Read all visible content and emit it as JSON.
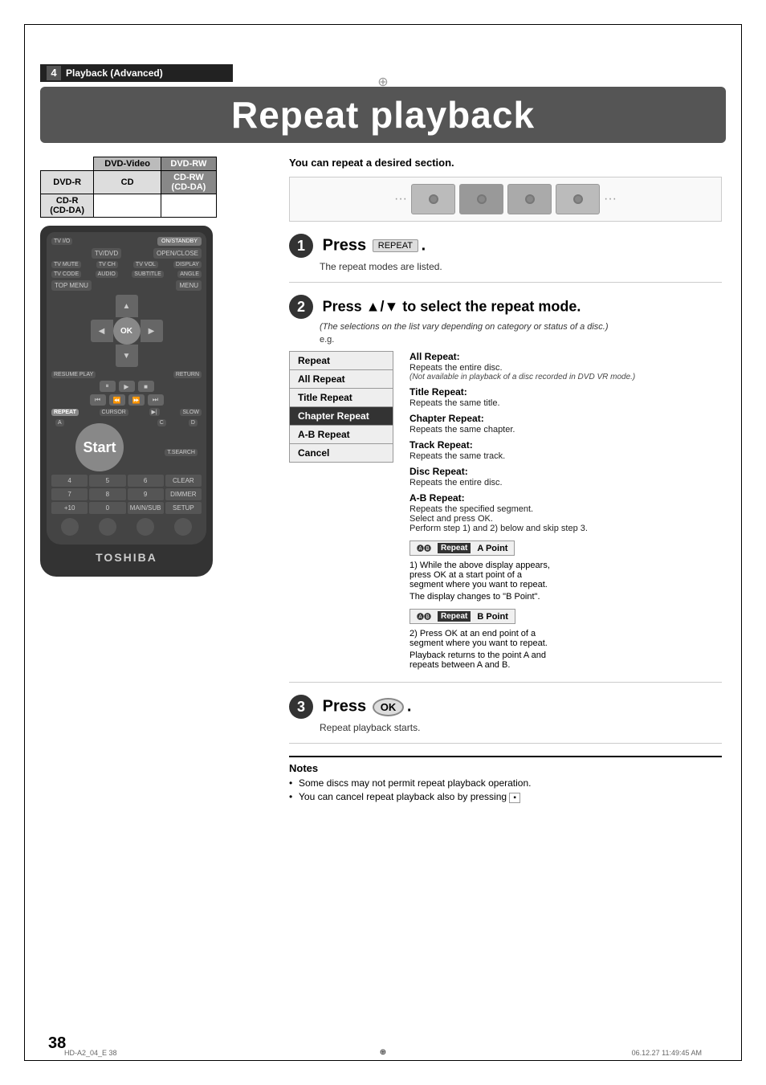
{
  "page": {
    "number": "38",
    "footer_left": "HD-A2_04_E  38",
    "footer_right": "06.12.27  11:49:45 AM",
    "crosshair": "⊕"
  },
  "chapter_header": {
    "number": "4",
    "text": "Playback (Advanced)"
  },
  "title": "Repeat playback",
  "subtitle": "You can repeat a desired section.",
  "disc_table": {
    "rows": [
      [
        "",
        "DVD-Video",
        "DVD-RW"
      ],
      [
        "DVD-R",
        "CD",
        "CD-RW\n(CD-DA)"
      ],
      [
        "CD-R\n(CD-DA)",
        "",
        ""
      ]
    ]
  },
  "toshiba_logo": "TOSHIBA",
  "steps": {
    "step1": {
      "number": "1",
      "label": "Press",
      "button": "REPEAT",
      "desc": "The repeat modes are listed."
    },
    "step2": {
      "number": "2",
      "label": "Press ▲/▼ to select the repeat mode.",
      "note": "(The selections on the list vary depending on category or status of a disc.)",
      "eg": "e.g.",
      "menu_items": [
        {
          "label": "Repeat",
          "selected": false
        },
        {
          "label": "All Repeat",
          "selected": false
        },
        {
          "label": "Title Repeat",
          "selected": false
        },
        {
          "label": "Chapter Repeat",
          "selected": true
        },
        {
          "label": "A-B Repeat",
          "selected": false
        },
        {
          "label": "Cancel",
          "selected": false
        }
      ],
      "descriptions": [
        {
          "title": "All Repeat:",
          "body": "Repeats the entire disc.",
          "note": "(Not available in playback of a disc recorded in DVD VR mode.)"
        },
        {
          "title": "Title Repeat:",
          "body": "Repeats the same title.",
          "note": ""
        },
        {
          "title": "Chapter Repeat:",
          "body": "Repeats the same chapter.",
          "note": ""
        },
        {
          "title": "Track Repeat:",
          "body": "Repeats the same track.",
          "note": ""
        },
        {
          "title": "Disc Repeat:",
          "body": "Repeats the entire disc.",
          "note": ""
        },
        {
          "title": "A-B Repeat:",
          "body": "Repeats the specified segment.\nSelect and press OK.\nPerform step 1) and 2) below and skip step 3.",
          "note": ""
        }
      ],
      "ab_steps": {
        "step1_text": "1) While the above display appears,\npress OK at a start point of a\nsegment where you want to repeat.",
        "display1_icon": "AB",
        "display1_label": "Repeat",
        "display1_point": "A Point",
        "change_text": "The display changes to \"B Point\".",
        "display2_icon": "AB",
        "display2_label": "Repeat",
        "display2_point": "B Point",
        "step2_text": "2) Press OK at an end point of a\nsegment where you want to repeat.",
        "result_text": "Playback returns to the point A and\nrepeats between A and B."
      }
    },
    "step3": {
      "number": "3",
      "label": "Press",
      "button": "OK",
      "desc": "Repeat playback starts."
    }
  },
  "notes": {
    "title": "Notes",
    "items": [
      "Some discs may not permit repeat playback operation.",
      "You can cancel repeat playback also by pressing  ▪"
    ]
  },
  "remote": {
    "buttons": {
      "tv_io": "TV I/O",
      "onstandby": "ON/STANDBY",
      "tvdvd": "TV/DVD",
      "openclose": "OPEN/CLOSE",
      "tv_mute": "TV MUTE",
      "tv_ch": "TV CH",
      "tv_vol": "TV VOL",
      "display": "DISPLAY",
      "tv_code": "TV CODE",
      "audio": "AUDIO",
      "subtitle": "SUBTITLE",
      "angle": "ANGLE",
      "top_menu": "TOP MENU",
      "menu": "MENU",
      "ok": "OK",
      "resume_play": "RESUME PLAY",
      "return": "RETURN",
      "repeat": "REPEAT",
      "cursor": "CURSOR",
      "slow": "SLOW",
      "t_search": "T.SEARCH",
      "clear": "CLEAR",
      "dimmer": "DIMMER",
      "main_sub": "MAIN/SUB",
      "setup": "SETUP"
    }
  }
}
